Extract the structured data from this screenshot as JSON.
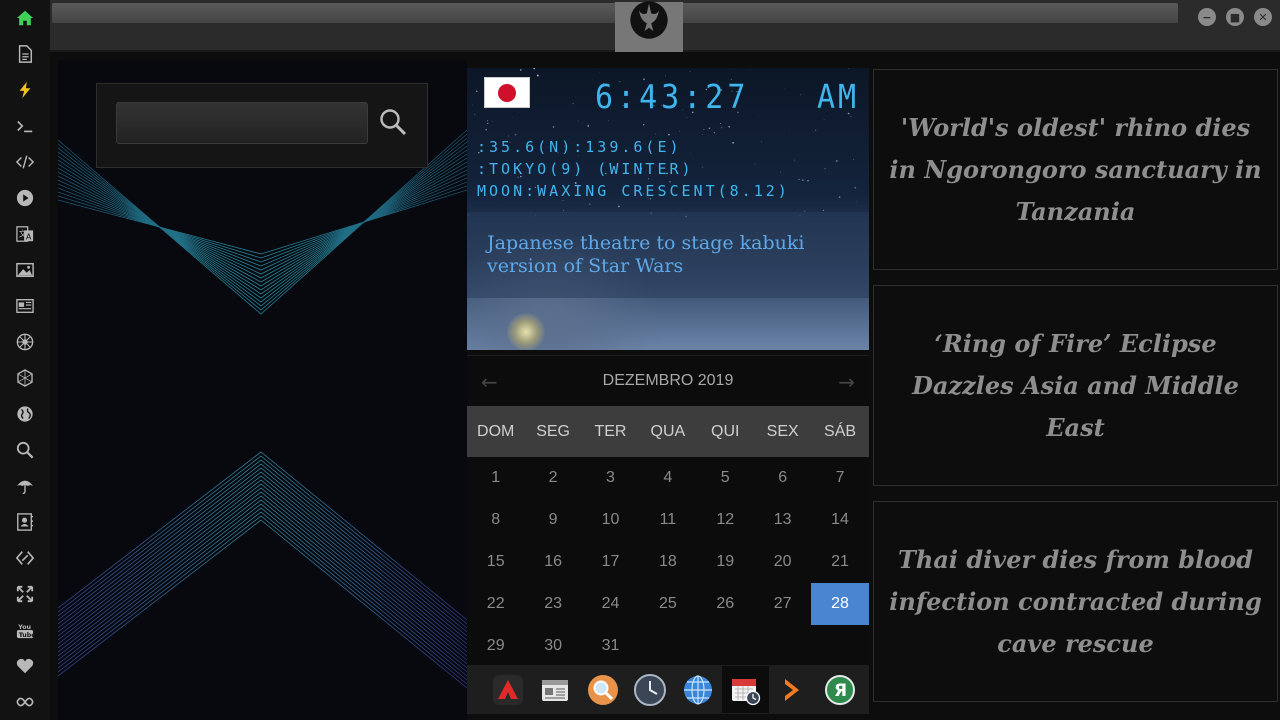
{
  "sidebar": {
    "items": [
      {
        "icon": "home-icon"
      },
      {
        "icon": "document-icon"
      },
      {
        "icon": "bolt-icon"
      },
      {
        "icon": "terminal-icon"
      },
      {
        "icon": "code-icon"
      },
      {
        "icon": "play-icon"
      },
      {
        "icon": "translate-icon"
      },
      {
        "icon": "image-icon"
      },
      {
        "icon": "newspaper-icon"
      },
      {
        "icon": "rebel-emblem-icon"
      },
      {
        "icon": "empire-emblem-icon"
      },
      {
        "icon": "globe-icon"
      },
      {
        "icon": "search-icon"
      },
      {
        "icon": "umbrella-icon"
      },
      {
        "icon": "contacts-icon"
      },
      {
        "icon": "diamond-link-icon"
      },
      {
        "icon": "expand-icon"
      },
      {
        "icon": "youtube-icon"
      },
      {
        "icon": "heart-icon"
      },
      {
        "icon": "infinity-icon"
      }
    ]
  },
  "topbar": {
    "emblem": "rebel-alliance-emblem",
    "window_buttons": [
      "minimize",
      "maximize",
      "close"
    ]
  },
  "search": {
    "value": "",
    "placeholder": ""
  },
  "clock": {
    "time": "6:43:27",
    "ampm": "AM",
    "coords": ":35.6(N):139.6(E)",
    "city": ":TOKYO(9) (WINTER)",
    "moon": "MOON:WAXING CRESCENT(8.12)",
    "headline": "Japanese theatre to stage kabuki version of Star Wars"
  },
  "calendar": {
    "month_label": "DEZEMBRO 2019",
    "weekdays": [
      "DOM",
      "SEG",
      "TER",
      "QUA",
      "QUI",
      "SEX",
      "SÁB"
    ],
    "weeks": [
      [
        "1",
        "2",
        "3",
        "4",
        "5",
        "6",
        "7"
      ],
      [
        "8",
        "9",
        "10",
        "11",
        "12",
        "13",
        "14"
      ],
      [
        "15",
        "16",
        "17",
        "18",
        "19",
        "20",
        "21"
      ],
      [
        "22",
        "23",
        "24",
        "25",
        "26",
        "27",
        "28"
      ],
      [
        "29",
        "30",
        "31",
        "",
        "",
        "",
        ""
      ]
    ],
    "selected_day": "28"
  },
  "dock": {
    "items": [
      {
        "icon": "red-triangle-app-icon"
      },
      {
        "icon": "news-app-icon"
      },
      {
        "icon": "search-app-icon"
      },
      {
        "icon": "clock-app-icon"
      },
      {
        "icon": "globe-app-icon"
      },
      {
        "icon": "calendar-app-icon",
        "active": true
      },
      {
        "icon": "chevron-app-icon"
      },
      {
        "icon": "r-app-icon"
      }
    ]
  },
  "news": [
    {
      "headline": "'World's oldest' rhino dies in Ngorongoro sanctuary in Tanzania"
    },
    {
      "headline": "‘Ring of Fire’ Eclipse Dazzles Asia and Middle East"
    },
    {
      "headline": "Thai diver dies from blood infection contracted during cave rescue"
    }
  ],
  "colors": {
    "accent": "#4a86d0",
    "clock_digits": "#3fb5ee",
    "home_icon": "#3bd15a",
    "bolt_icon": "#f0c419"
  }
}
